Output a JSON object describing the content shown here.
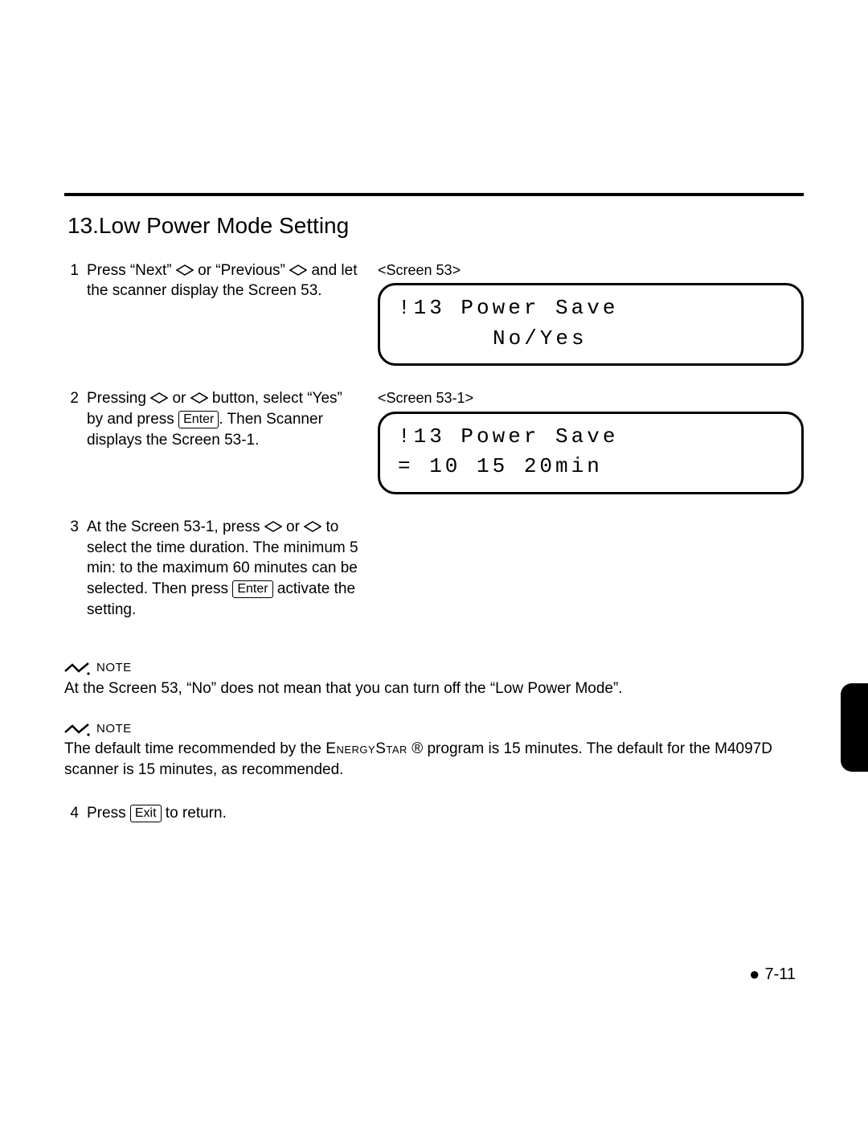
{
  "section": {
    "title": "13.Low Power Mode Setting"
  },
  "steps": {
    "s1": {
      "num": "1",
      "part1": "Press “Next” ",
      "part2": " or “Previous” ",
      "part3": " and let the scanner display the Screen 53."
    },
    "s2": {
      "num": "2",
      "part1": "Pressing ",
      "part2": " or ",
      "part3": " button, select “Yes” by and press ",
      "enter": "Enter",
      "part4": ". Then Scanner displays the Screen 53-1."
    },
    "s3": {
      "num": "3",
      "part1": "At the Screen 53-1, press ",
      "part2": " or ",
      "part3": " to select the time duration. The minimum 5 min: to the maximum 60 minutes can be selected. Then press ",
      "enter": "Enter",
      "part4": " activate the setting."
    },
    "s4": {
      "num": "4",
      "part1": "Press ",
      "exit": "Exit",
      "part2": " to return."
    }
  },
  "screens": {
    "a": {
      "caption": "<Screen 53>",
      "line1": "!13 Power Save",
      "line2": "No/Yes"
    },
    "b": {
      "caption": "<Screen 53-1>",
      "line1": "!13 Power Save",
      "line2": "=  10  15  20min"
    }
  },
  "notes": {
    "label": "NOTE",
    "n1": "At the Screen 53, “No” does not mean that you can turn off the “Low Power Mode”.",
    "n2a": "The default time recommended by the ",
    "n2brand": "EnergyStar",
    "n2b": " ® program is 15 minutes.  The default for the M4097D scanner is 15 minutes, as recommended."
  },
  "pagenum": "7-11"
}
